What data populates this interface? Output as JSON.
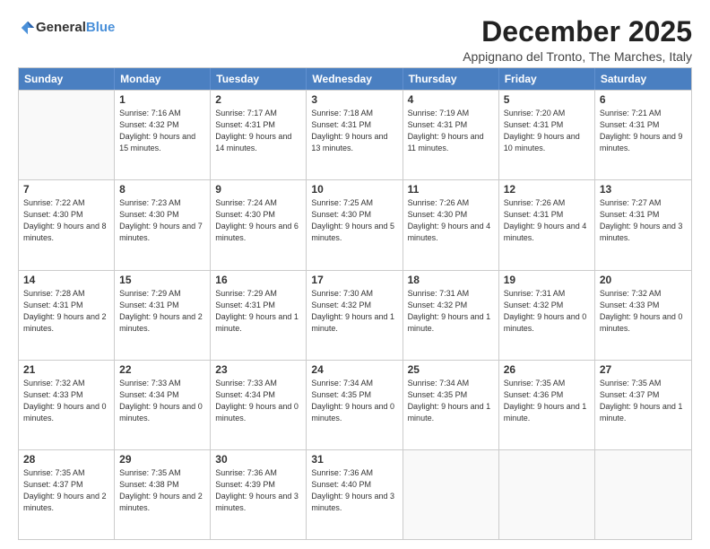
{
  "logo": {
    "general": "General",
    "blue": "Blue"
  },
  "title": "December 2025",
  "location": "Appignano del Tronto, The Marches, Italy",
  "days_of_week": [
    "Sunday",
    "Monday",
    "Tuesday",
    "Wednesday",
    "Thursday",
    "Friday",
    "Saturday"
  ],
  "weeks": [
    [
      {
        "day": "",
        "empty": true
      },
      {
        "day": "1",
        "sunrise": "7:16 AM",
        "sunset": "4:32 PM",
        "daylight": "9 hours and 15 minutes."
      },
      {
        "day": "2",
        "sunrise": "7:17 AM",
        "sunset": "4:31 PM",
        "daylight": "9 hours and 14 minutes."
      },
      {
        "day": "3",
        "sunrise": "7:18 AM",
        "sunset": "4:31 PM",
        "daylight": "9 hours and 13 minutes."
      },
      {
        "day": "4",
        "sunrise": "7:19 AM",
        "sunset": "4:31 PM",
        "daylight": "9 hours and 11 minutes."
      },
      {
        "day": "5",
        "sunrise": "7:20 AM",
        "sunset": "4:31 PM",
        "daylight": "9 hours and 10 minutes."
      },
      {
        "day": "6",
        "sunrise": "7:21 AM",
        "sunset": "4:31 PM",
        "daylight": "9 hours and 9 minutes."
      }
    ],
    [
      {
        "day": "7",
        "sunrise": "7:22 AM",
        "sunset": "4:30 PM",
        "daylight": "9 hours and 8 minutes."
      },
      {
        "day": "8",
        "sunrise": "7:23 AM",
        "sunset": "4:30 PM",
        "daylight": "9 hours and 7 minutes."
      },
      {
        "day": "9",
        "sunrise": "7:24 AM",
        "sunset": "4:30 PM",
        "daylight": "9 hours and 6 minutes."
      },
      {
        "day": "10",
        "sunrise": "7:25 AM",
        "sunset": "4:30 PM",
        "daylight": "9 hours and 5 minutes."
      },
      {
        "day": "11",
        "sunrise": "7:26 AM",
        "sunset": "4:30 PM",
        "daylight": "9 hours and 4 minutes."
      },
      {
        "day": "12",
        "sunrise": "7:26 AM",
        "sunset": "4:31 PM",
        "daylight": "9 hours and 4 minutes."
      },
      {
        "day": "13",
        "sunrise": "7:27 AM",
        "sunset": "4:31 PM",
        "daylight": "9 hours and 3 minutes."
      }
    ],
    [
      {
        "day": "14",
        "sunrise": "7:28 AM",
        "sunset": "4:31 PM",
        "daylight": "9 hours and 2 minutes."
      },
      {
        "day": "15",
        "sunrise": "7:29 AM",
        "sunset": "4:31 PM",
        "daylight": "9 hours and 2 minutes."
      },
      {
        "day": "16",
        "sunrise": "7:29 AM",
        "sunset": "4:31 PM",
        "daylight": "9 hours and 1 minute."
      },
      {
        "day": "17",
        "sunrise": "7:30 AM",
        "sunset": "4:32 PM",
        "daylight": "9 hours and 1 minute."
      },
      {
        "day": "18",
        "sunrise": "7:31 AM",
        "sunset": "4:32 PM",
        "daylight": "9 hours and 1 minute."
      },
      {
        "day": "19",
        "sunrise": "7:31 AM",
        "sunset": "4:32 PM",
        "daylight": "9 hours and 0 minutes."
      },
      {
        "day": "20",
        "sunrise": "7:32 AM",
        "sunset": "4:33 PM",
        "daylight": "9 hours and 0 minutes."
      }
    ],
    [
      {
        "day": "21",
        "sunrise": "7:32 AM",
        "sunset": "4:33 PM",
        "daylight": "9 hours and 0 minutes."
      },
      {
        "day": "22",
        "sunrise": "7:33 AM",
        "sunset": "4:34 PM",
        "daylight": "9 hours and 0 minutes."
      },
      {
        "day": "23",
        "sunrise": "7:33 AM",
        "sunset": "4:34 PM",
        "daylight": "9 hours and 0 minutes."
      },
      {
        "day": "24",
        "sunrise": "7:34 AM",
        "sunset": "4:35 PM",
        "daylight": "9 hours and 0 minutes."
      },
      {
        "day": "25",
        "sunrise": "7:34 AM",
        "sunset": "4:35 PM",
        "daylight": "9 hours and 1 minute."
      },
      {
        "day": "26",
        "sunrise": "7:35 AM",
        "sunset": "4:36 PM",
        "daylight": "9 hours and 1 minute."
      },
      {
        "day": "27",
        "sunrise": "7:35 AM",
        "sunset": "4:37 PM",
        "daylight": "9 hours and 1 minute."
      }
    ],
    [
      {
        "day": "28",
        "sunrise": "7:35 AM",
        "sunset": "4:37 PM",
        "daylight": "9 hours and 2 minutes."
      },
      {
        "day": "29",
        "sunrise": "7:35 AM",
        "sunset": "4:38 PM",
        "daylight": "9 hours and 2 minutes."
      },
      {
        "day": "30",
        "sunrise": "7:36 AM",
        "sunset": "4:39 PM",
        "daylight": "9 hours and 3 minutes."
      },
      {
        "day": "31",
        "sunrise": "7:36 AM",
        "sunset": "4:40 PM",
        "daylight": "9 hours and 3 minutes."
      },
      {
        "day": "",
        "empty": true
      },
      {
        "day": "",
        "empty": true
      },
      {
        "day": "",
        "empty": true
      }
    ]
  ]
}
